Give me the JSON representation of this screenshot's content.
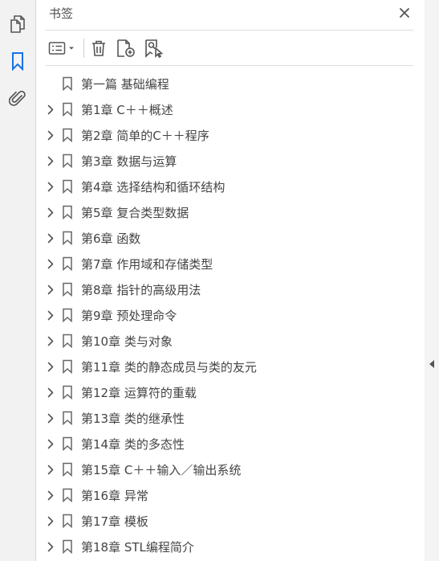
{
  "panel": {
    "title": "书签",
    "icons": {
      "close": "close-icon",
      "options": "list-options-icon",
      "delete": "trash-icon",
      "new_bookmark": "new-bookmark-icon",
      "bookmark_from_selection": "bookmark-search-icon"
    }
  },
  "rail": {
    "icons": [
      "pages-icon",
      "bookmark-icon",
      "paperclip-icon"
    ],
    "active": "bookmark-icon",
    "accent": "#1473e6"
  },
  "bookmarks": [
    {
      "label": "第一篇  基础编程",
      "expandable": false
    },
    {
      "label": "第1章  C＋＋概述",
      "expandable": true
    },
    {
      "label": "第2章  简单的C＋＋程序",
      "expandable": true
    },
    {
      "label": "第3章  数据与运算",
      "expandable": true
    },
    {
      "label": "第4章  选择结构和循环结构",
      "expandable": true
    },
    {
      "label": "第5章  复合类型数据",
      "expandable": true
    },
    {
      "label": "第6章  函数",
      "expandable": true
    },
    {
      "label": "第7章  作用域和存储类型",
      "expandable": true
    },
    {
      "label": "第8章  指针的高级用法",
      "expandable": true
    },
    {
      "label": "第9章  预处理命令",
      "expandable": true
    },
    {
      "label": "第10章  类与对象",
      "expandable": true
    },
    {
      "label": "第11章  类的静态成员与类的友元",
      "expandable": true
    },
    {
      "label": "第12章  运算符的重载",
      "expandable": true
    },
    {
      "label": "第13章  类的继承性",
      "expandable": true
    },
    {
      "label": "第14章  类的多态性",
      "expandable": true
    },
    {
      "label": "第15章  C＋＋输入／输出系统",
      "expandable": true
    },
    {
      "label": "第16章  异常",
      "expandable": true
    },
    {
      "label": "第17章  模板",
      "expandable": true
    },
    {
      "label": "第18章  STL编程简介",
      "expandable": true
    }
  ]
}
